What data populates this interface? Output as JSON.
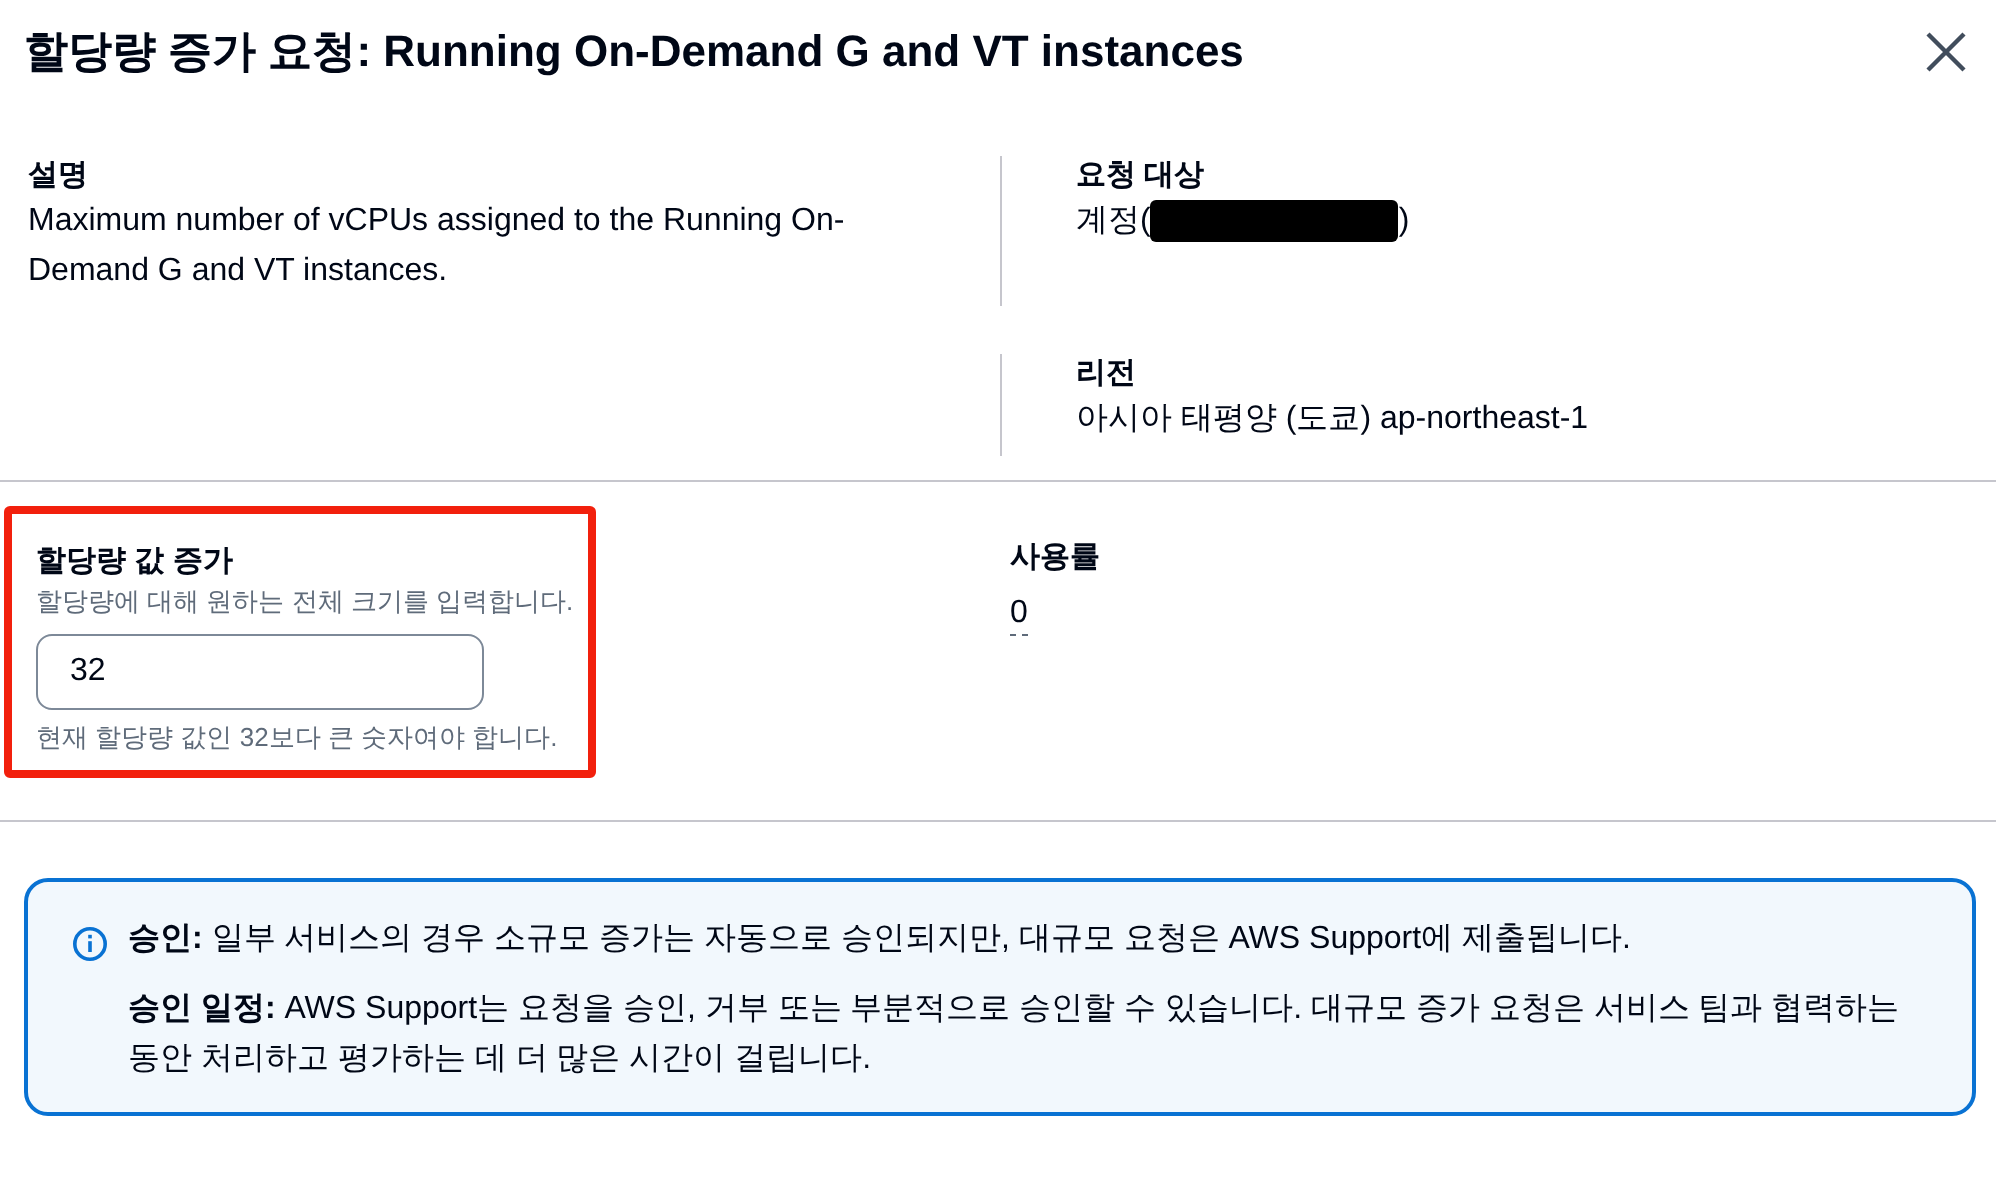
{
  "window": {
    "title": "할당량 증가 요청: Running On-Demand G and VT instances"
  },
  "details": {
    "description_label": "설명",
    "description": "Maximum number of vCPUs assigned to the Running On-Demand G and VT instances.",
    "target_label": "요청 대상",
    "target_prefix": "계정(",
    "target_suffix": ")",
    "region_label": "리전",
    "region": "아시아 태평양 (도쿄) ap-northeast-1"
  },
  "quota": {
    "label": "할당량 값 증가",
    "hint": "할당량에 대해 원하는 전체 크기를 입력합니다.",
    "value": "32",
    "constraint": "현재 할당량 값인 32보다 큰 숫자여야 합니다.",
    "highlighted": true
  },
  "usage": {
    "label": "사용률",
    "value": "0"
  },
  "info": {
    "paragraphs": [
      "**승인:** 일부 서비스의 경우 소규모 증가는 자동으로 승인되지만, 대규모 요청은 AWS Support에 제출됩니다.",
      "**승인 일정:** AWS Support는 요청을 승인, 거부 또는 부분적으로 승인할 수 있습니다. 대규모 증가 요청은 서비스 팀과 협력하는 동안 처리하고 평가하는 데 더 많은 시간이 걸립니다."
    ]
  }
}
